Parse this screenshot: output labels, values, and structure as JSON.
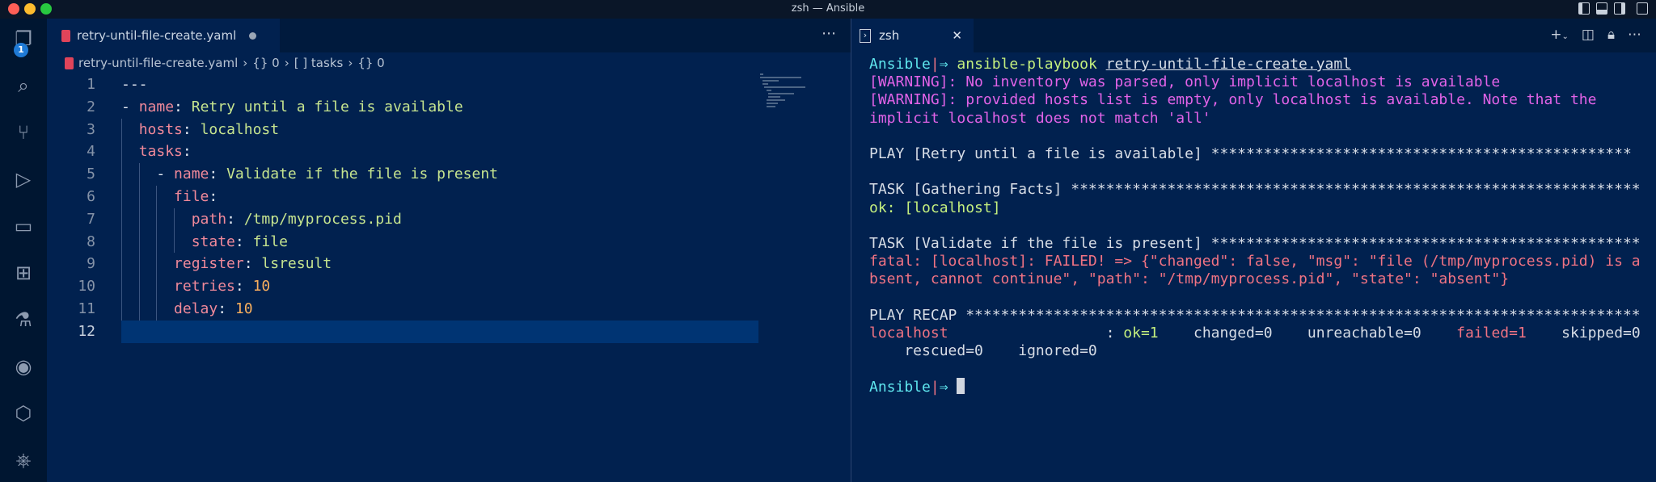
{
  "window": {
    "title": "zsh — Ansible"
  },
  "activity_bar": {
    "explorer_badge": "1",
    "items": [
      "explorer",
      "search",
      "source-control",
      "run-debug",
      "remote-explorer",
      "extensions",
      "testing",
      "github",
      "deploy",
      "kubernetes"
    ]
  },
  "editor": {
    "tab": {
      "label": "retry-until-file-create.yaml",
      "modified": true
    },
    "breadcrumb": [
      "retry-until-file-create.yaml",
      "{} 0",
      "[ ] tasks",
      "{} 0"
    ],
    "current_line": 12,
    "lines": [
      [
        {
          "t": "---",
          "c": "punc"
        }
      ],
      [
        {
          "t": "- ",
          "c": "punc"
        },
        {
          "t": "name",
          "c": "key"
        },
        {
          "t": ": ",
          "c": "punc"
        },
        {
          "t": "Retry until a file is available",
          "c": "str"
        }
      ],
      [
        {
          "t": "  ",
          "c": "punc"
        },
        {
          "t": "hosts",
          "c": "key"
        },
        {
          "t": ": ",
          "c": "punc"
        },
        {
          "t": "localhost",
          "c": "str"
        }
      ],
      [
        {
          "t": "  ",
          "c": "punc"
        },
        {
          "t": "tasks",
          "c": "key"
        },
        {
          "t": ":",
          "c": "punc"
        }
      ],
      [
        {
          "t": "    - ",
          "c": "punc"
        },
        {
          "t": "name",
          "c": "key"
        },
        {
          "t": ": ",
          "c": "punc"
        },
        {
          "t": "Validate if the file is present",
          "c": "str"
        }
      ],
      [
        {
          "t": "      ",
          "c": "punc"
        },
        {
          "t": "file",
          "c": "key"
        },
        {
          "t": ":",
          "c": "punc"
        }
      ],
      [
        {
          "t": "        ",
          "c": "punc"
        },
        {
          "t": "path",
          "c": "key"
        },
        {
          "t": ": ",
          "c": "punc"
        },
        {
          "t": "/tmp/myprocess.pid",
          "c": "str"
        }
      ],
      [
        {
          "t": "        ",
          "c": "punc"
        },
        {
          "t": "state",
          "c": "key"
        },
        {
          "t": ": ",
          "c": "punc"
        },
        {
          "t": "file",
          "c": "str"
        }
      ],
      [
        {
          "t": "      ",
          "c": "punc"
        },
        {
          "t": "register",
          "c": "key"
        },
        {
          "t": ": ",
          "c": "punc"
        },
        {
          "t": "lsresult",
          "c": "str"
        }
      ],
      [
        {
          "t": "      ",
          "c": "punc"
        },
        {
          "t": "retries",
          "c": "key"
        },
        {
          "t": ": ",
          "c": "punc"
        },
        {
          "t": "10",
          "c": "num"
        }
      ],
      [
        {
          "t": "      ",
          "c": "punc"
        },
        {
          "t": "delay",
          "c": "key"
        },
        {
          "t": ": ",
          "c": "punc"
        },
        {
          "t": "10",
          "c": "num"
        }
      ],
      []
    ]
  },
  "terminal": {
    "tab": {
      "label": "zsh"
    },
    "lines": [
      [
        {
          "t": "Ansible",
          "c": "cy"
        },
        {
          "t": "|",
          "c": "rd"
        },
        {
          "t": "⇒ ",
          "c": "cy"
        },
        {
          "t": "ansible-playbook ",
          "c": "gr"
        },
        {
          "t": "retry-until-file-create.yaml",
          "c": "u"
        }
      ],
      [
        {
          "t": "[WARNING]: No inventory was parsed, only implicit localhost is available",
          "c": "mg"
        }
      ],
      [
        {
          "t": "[WARNING]: provided hosts list is empty, only localhost is available. Note that the",
          "c": "mg"
        }
      ],
      [
        {
          "t": "implicit localhost does not match 'all'",
          "c": "mg"
        }
      ],
      [],
      [
        {
          "t": "PLAY [Retry until a file is available] ************************************************",
          "c": ""
        }
      ],
      [],
      [
        {
          "t": "TASK [Gathering Facts] *****************************************************************",
          "c": ""
        }
      ],
      [
        {
          "t": "ok: [localhost]",
          "c": "gr"
        }
      ],
      [],
      [
        {
          "t": "TASK [Validate if the file is present] *************************************************",
          "c": ""
        }
      ],
      [
        {
          "t": "fatal: [localhost]: FAILED! => {\"changed\": false, \"msg\": \"file (/tmp/myprocess.pid) is a",
          "c": "rd"
        }
      ],
      [
        {
          "t": "bsent, cannot continue\", \"path\": \"/tmp/myprocess.pid\", \"state\": \"absent\"}",
          "c": "rd"
        }
      ],
      [],
      [
        {
          "t": "PLAY RECAP *****************************************************************************",
          "c": ""
        }
      ],
      [
        {
          "t": "localhost",
          "c": "rd"
        },
        {
          "t": "                  : ",
          "c": ""
        },
        {
          "t": "ok=1",
          "c": "gr"
        },
        {
          "t": "    changed=0    unreachable=0    ",
          "c": ""
        },
        {
          "t": "failed=1",
          "c": "rd"
        },
        {
          "t": "    skipped=0",
          "c": ""
        }
      ],
      [
        {
          "t": "    rescued=0    ignored=0",
          "c": ""
        }
      ],
      [],
      [
        {
          "t": "Ansible",
          "c": "cy"
        },
        {
          "t": "|",
          "c": "rd"
        },
        {
          "t": "⇒ ",
          "c": "cy"
        }
      ]
    ]
  }
}
